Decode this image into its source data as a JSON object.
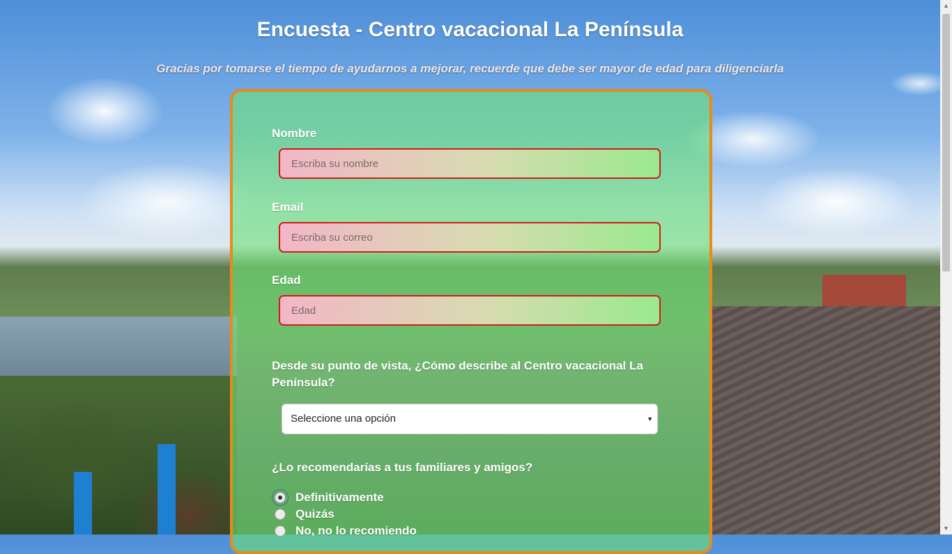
{
  "header": {
    "title": "Encuesta - Centro vacacional La Península",
    "subtitle": "Gracias por tomarse el tiempo de ayudarnos a mejorar, recuerde que debe ser mayor de edad para diligenciarla"
  },
  "form": {
    "name": {
      "label": "Nombre",
      "placeholder": "Escriba su nombre"
    },
    "email": {
      "label": "Email",
      "placeholder": "Escriba su correo"
    },
    "age": {
      "label": "Edad",
      "placeholder": "Edad"
    },
    "description": {
      "question": "Desde su punto de vista, ¿Cómo describe al Centro vacacional La Península?",
      "selected": "Seleccione una opción"
    },
    "recommend": {
      "question": "¿Lo recomendarías a tus familiares y amigos?",
      "options": [
        "Definitivamente",
        "Quizás",
        "No, no lo recomiendo"
      ],
      "selected_index": 0
    }
  },
  "colors": {
    "card_border": "#e98a1a",
    "input_border": "#d11a1a",
    "card_fill": "#6ee178"
  }
}
